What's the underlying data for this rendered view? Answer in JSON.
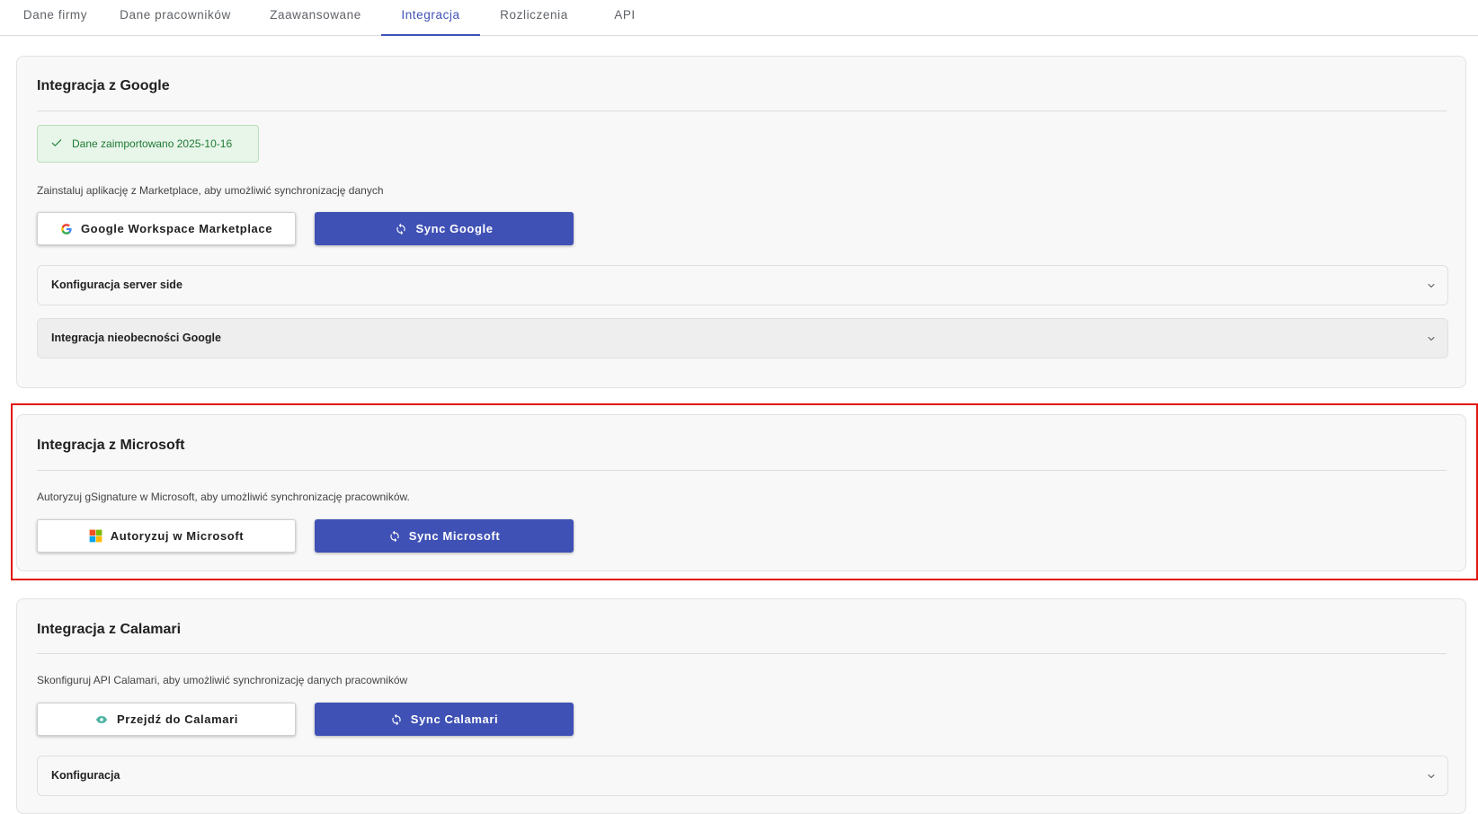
{
  "tabs": [
    {
      "label": "Dane firmy",
      "active": false
    },
    {
      "label": "Dane pracowników",
      "active": false
    },
    {
      "label": "Zaawansowane",
      "active": false
    },
    {
      "label": "Integracja",
      "active": true
    },
    {
      "label": "Rozliczenia",
      "active": false
    },
    {
      "label": "API",
      "active": false
    }
  ],
  "google": {
    "title": "Integracja z Google",
    "alert_text": "Dane zaimportowano 2025-10-16",
    "description": "Zainstaluj aplikację z Marketplace, aby umożliwić synchronizację danych",
    "marketplace_button": "Google Workspace Marketplace",
    "sync_button": "Sync Google",
    "accordions": [
      {
        "label": "Konfiguracja server side"
      },
      {
        "label": "Integracja nieobecności Google"
      }
    ]
  },
  "microsoft": {
    "title": "Integracja z Microsoft",
    "description": "Autoryzuj gSignature w Microsoft, aby umożliwić synchronizację pracowników.",
    "authorize_button": "Autoryzuj w Microsoft",
    "sync_button": "Sync Microsoft"
  },
  "calamari": {
    "title": "Integracja z Calamari",
    "description": "Skonfiguruj API Calamari, aby umożliwić synchronizację danych pracowników",
    "goto_button": "Przejdź do Calamari",
    "sync_button": "Sync Calamari",
    "accordions": [
      {
        "label": "Konfiguracja"
      }
    ]
  },
  "colors": {
    "primary": "#3f51b5",
    "success_text": "#1e7a34",
    "success_bg": "#e8f5e9",
    "highlight": "#e21414"
  },
  "icons": {
    "alert": "check-icon",
    "sync": "sync-icon",
    "google": "google-logo-icon",
    "microsoft": "microsoft-logo-icon",
    "calamari": "calamari-logo-icon",
    "accordion": "chevron-down-icon"
  }
}
